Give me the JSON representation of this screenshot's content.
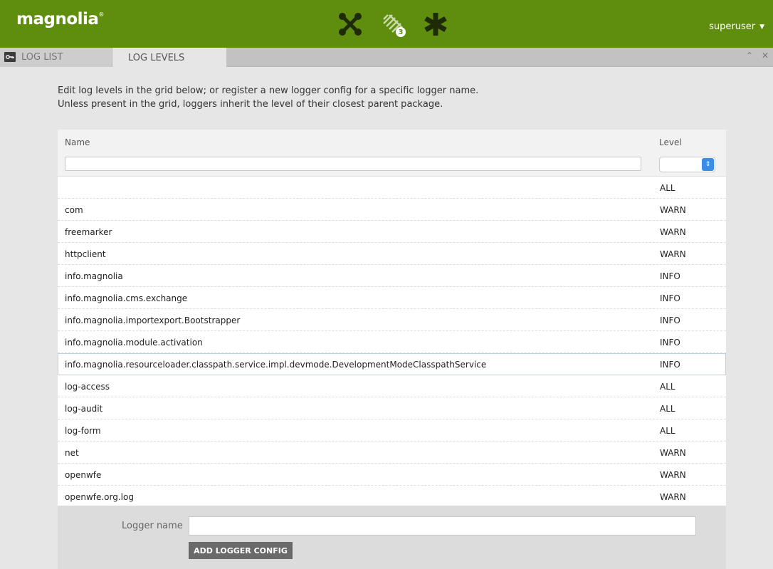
{
  "header": {
    "logo_text": "magnolia",
    "logo_mark": "®",
    "apps": [
      {
        "icon": "shuffle-x-icon"
      },
      {
        "icon": "pulse-icon",
        "badge": "3"
      },
      {
        "icon": "asterisk-icon"
      }
    ],
    "user": "superuser"
  },
  "tabs": [
    {
      "label": "LOG LIST",
      "icon": "key-icon"
    },
    {
      "label": "LOG LEVELS"
    }
  ],
  "intro": {
    "line1": "Edit log levels in the grid below; or register a new logger config for a specific logger name.",
    "line2": "Unless present in the grid, loggers inherit the level of their closest parent package."
  },
  "grid": {
    "col_name": "Name",
    "col_level": "Level",
    "rows": [
      {
        "name": "",
        "level": "ALL"
      },
      {
        "name": "com",
        "level": "WARN"
      },
      {
        "name": "freemarker",
        "level": "WARN"
      },
      {
        "name": "httpclient",
        "level": "WARN"
      },
      {
        "name": "info.magnolia",
        "level": "INFO"
      },
      {
        "name": "info.magnolia.cms.exchange",
        "level": "INFO"
      },
      {
        "name": "info.magnolia.importexport.Bootstrapper",
        "level": "INFO"
      },
      {
        "name": "info.magnolia.module.activation",
        "level": "INFO"
      },
      {
        "name": "info.magnolia.resourceloader.classpath.service.impl.devmode.DevelopmentModeClasspathService",
        "level": "INFO"
      },
      {
        "name": "log-access",
        "level": "ALL"
      },
      {
        "name": "log-audit",
        "level": "ALL"
      },
      {
        "name": "log-form",
        "level": "ALL"
      },
      {
        "name": "net",
        "level": "WARN"
      },
      {
        "name": "openwfe",
        "level": "WARN"
      },
      {
        "name": "openwfe.org.log",
        "level": "WARN"
      }
    ]
  },
  "footer": {
    "logger_label": "Logger name",
    "logger_value": "",
    "add_button": "ADD LOGGER CONFIG"
  }
}
